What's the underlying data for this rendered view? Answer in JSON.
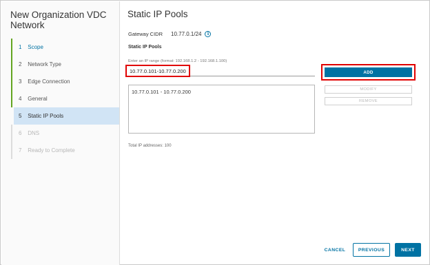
{
  "wizard": {
    "title": "New Organization VDC Network",
    "steps": [
      {
        "num": "1",
        "label": "Scope",
        "state": "done"
      },
      {
        "num": "2",
        "label": "Network Type",
        "state": "done"
      },
      {
        "num": "3",
        "label": "Edge Connection",
        "state": "done"
      },
      {
        "num": "4",
        "label": "General",
        "state": "done"
      },
      {
        "num": "5",
        "label": "Static IP Pools",
        "state": "current"
      },
      {
        "num": "6",
        "label": "DNS",
        "state": "pending"
      },
      {
        "num": "7",
        "label": "Ready to Complete",
        "state": "pending"
      }
    ]
  },
  "main": {
    "title": "Static IP Pools",
    "gateway_cidr_label": "Gateway CIDR",
    "gateway_cidr_value": "10.77.0.1/24",
    "info_icon": "i",
    "section_title": "Static IP Pools",
    "input_hint": "Enter an IP range (format: 192.168.1.2 - 192.168.1.100)",
    "input_value": "10.77.0.101-10.77.0.200",
    "pools": [
      "10.77.0.101 - 10.77.0.200"
    ],
    "add_label": "ADD",
    "modify_label": "MODIFY",
    "remove_label": "REMOVE",
    "total_label": "Total IP addresses: 100"
  },
  "footer": {
    "cancel_label": "CANCEL",
    "previous_label": "PREVIOUS",
    "next_label": "NEXT"
  },
  "colors": {
    "accent": "#0072a3",
    "done": "#62a420",
    "current_bg": "#d1e4f5",
    "highlight": "#e00000"
  }
}
